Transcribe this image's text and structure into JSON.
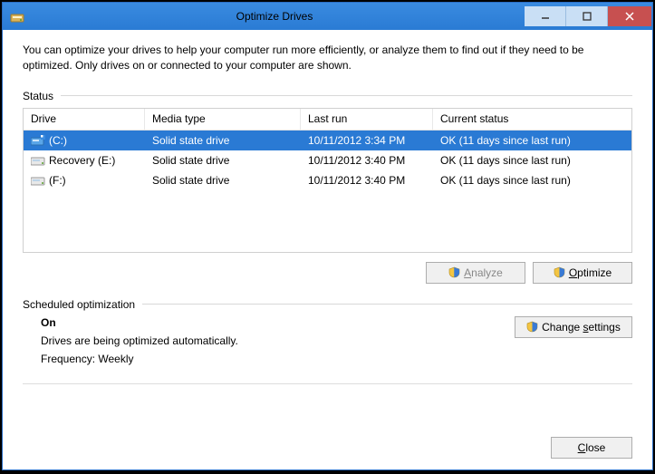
{
  "window": {
    "title": "Optimize Drives"
  },
  "description": "You can optimize your drives to help your computer run more efficiently, or analyze them to find out if they need to be optimized. Only drives on or connected to your computer are shown.",
  "status_label": "Status",
  "columns": {
    "drive": "Drive",
    "media": "Media type",
    "last": "Last run",
    "status": "Current status"
  },
  "drives": [
    {
      "name": "(C:)",
      "media": "Solid state drive",
      "last": "10/11/2012 3:34 PM",
      "status": "OK (11 days since last run)",
      "selected": true,
      "icon": "system"
    },
    {
      "name": "Recovery (E:)",
      "media": "Solid state drive",
      "last": "10/11/2012 3:40 PM",
      "status": "OK (11 days since last run)",
      "selected": false,
      "icon": "hdd"
    },
    {
      "name": "(F:)",
      "media": "Solid state drive",
      "last": "10/11/2012 3:40 PM",
      "status": "OK (11 days since last run)",
      "selected": false,
      "icon": "hdd"
    }
  ],
  "buttons": {
    "analyze": "Analyze",
    "optimize": "Optimize",
    "change_settings": "Change settings",
    "close": "Close"
  },
  "schedule": {
    "label": "Scheduled optimization",
    "state": "On",
    "desc": "Drives are being optimized automatically.",
    "freq": "Frequency: Weekly"
  }
}
